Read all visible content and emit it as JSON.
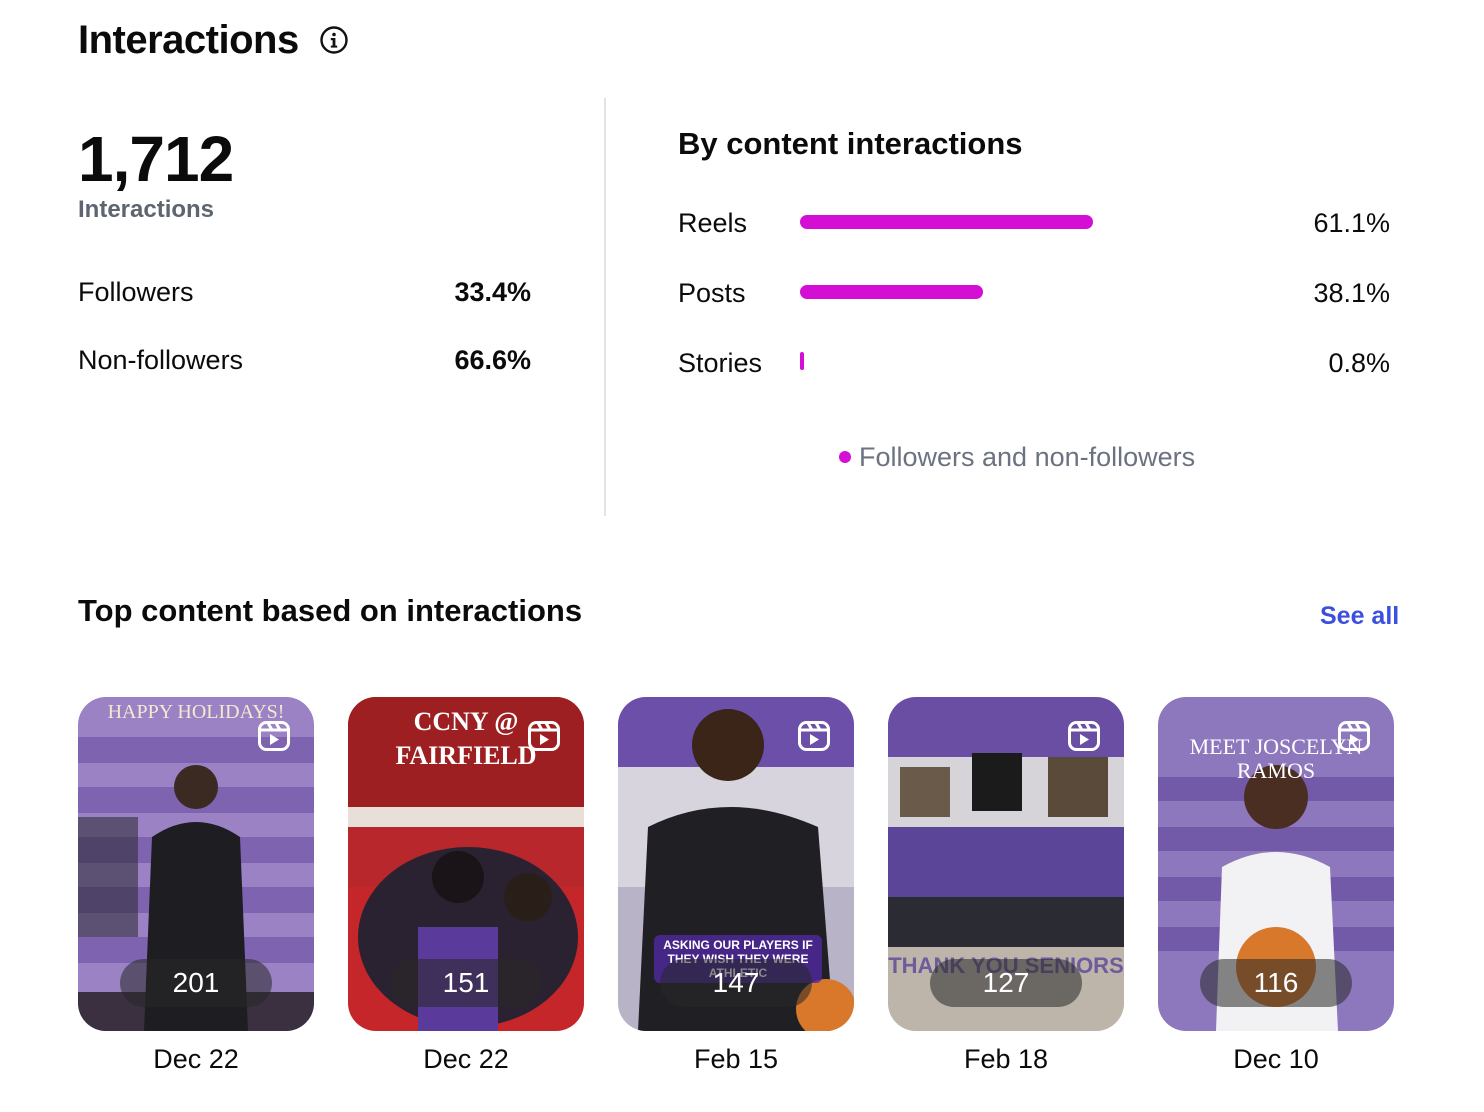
{
  "header": {
    "title": "Interactions",
    "info_icon": "info-circle-icon"
  },
  "summary": {
    "total": "1,712",
    "total_label": "Interactions",
    "rows": [
      {
        "label": "Followers",
        "value": "33.4%"
      },
      {
        "label": "Non-followers",
        "value": "66.6%"
      }
    ]
  },
  "by_content": {
    "title": "By content interactions",
    "accent": "#d40ed4",
    "items": [
      {
        "label": "Reels",
        "value": "61.1%",
        "fraction": 0.611
      },
      {
        "label": "Posts",
        "value": "38.1%",
        "fraction": 0.381
      },
      {
        "label": "Stories",
        "value": "0.8%",
        "fraction": 0.008
      }
    ],
    "legend": "Followers and non-followers"
  },
  "top_content": {
    "title": "Top content based on interactions",
    "see_all": "See all",
    "link_color": "#3b4fe0",
    "items": [
      {
        "count": "201",
        "date": "Dec 22",
        "overlay_text": "HAPPY HOLIDAYS!",
        "type_icon": "reel-icon"
      },
      {
        "count": "151",
        "date": "Dec 22",
        "overlay_text": "CCNY @ FAIRFIELD",
        "type_icon": "reel-icon"
      },
      {
        "count": "147",
        "date": "Feb 15",
        "overlay_text": "ASKING OUR PLAYERS IF THEY WISH THEY WERE ATHLETIC",
        "type_icon": "reel-icon"
      },
      {
        "count": "127",
        "date": "Feb 18",
        "overlay_text": "THANK YOU SENIORS",
        "type_icon": "reel-icon"
      },
      {
        "count": "116",
        "date": "Dec 10",
        "overlay_text": "MEET JOSCELYN RAMOS",
        "type_icon": "reel-icon"
      }
    ]
  }
}
